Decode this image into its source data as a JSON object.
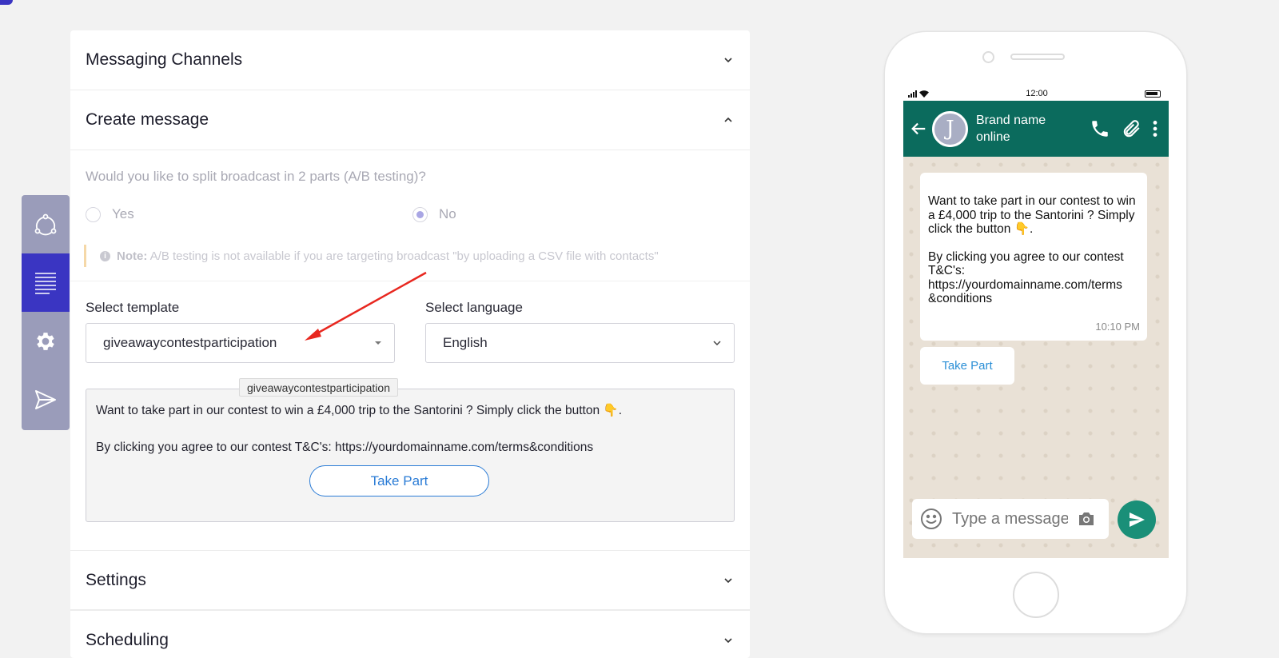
{
  "sections": {
    "channels": {
      "title": "Messaging Channels"
    },
    "create": {
      "title": "Create message"
    },
    "settings": {
      "title": "Settings"
    },
    "scheduling": {
      "title": "Scheduling"
    }
  },
  "split": {
    "question": "Would you like to split broadcast in 2 parts (A/B testing)?",
    "yes_label": "Yes",
    "no_label": "No",
    "selected": "No"
  },
  "note": {
    "label": "Note:",
    "text": "A/B testing is not available if you are targeting broadcast \"by uploading a CSV file with contacts\""
  },
  "template": {
    "label": "Select template",
    "value": "giveawaycontestparticipation",
    "tooltip": "giveawaycontestparticipation"
  },
  "language": {
    "label": "Select language",
    "value": "English"
  },
  "preview": {
    "line1": "Want to take part in our contest to win a £4,000 trip to the Santorini ? Simply click the button 👇.",
    "line2": "By clicking you agree to our contest T&C's: https://yourdomainname.com/terms&conditions",
    "button": "Take Part"
  },
  "phone": {
    "time": "12:00",
    "brand_name": "Brand name",
    "status": "online",
    "avatar_letter": "J",
    "message_p1": "Want to take part in our contest to win a £4,000 trip to the Santorini ? Simply click the button 👇.",
    "message_p2": "By clicking you agree to our contest T&C's: https://yourdomainname.com/terms &conditions",
    "message_time": "10:10 PM",
    "button": "Take Part",
    "composer_placeholder": "Type a message"
  },
  "colors": {
    "accent": "#3a35c2",
    "sidebar": "#9a9cba",
    "wa_header": "#0b6b5d",
    "wa_send": "#1a8f78",
    "link_blue": "#2b7cd6",
    "arrow": "#e8271f"
  }
}
